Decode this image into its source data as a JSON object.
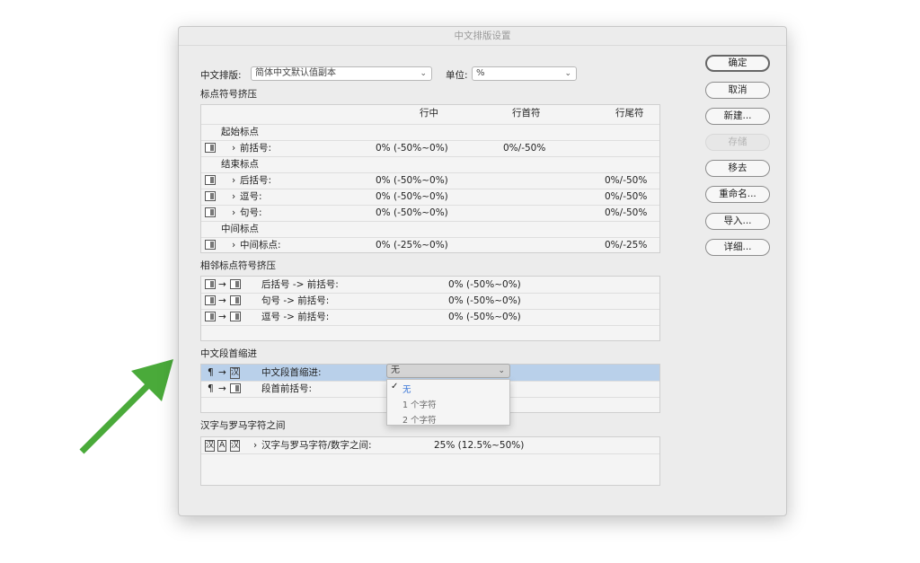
{
  "dialog": {
    "title": "中文排版设置"
  },
  "top": {
    "set_label": "中文排版:",
    "set_value": "简体中文默认值副本",
    "unit_label": "单位:",
    "unit_value": "%"
  },
  "punct": {
    "section": "标点符号挤压",
    "headers": [
      "行中",
      "行首符",
      "行尾符"
    ],
    "rows": [
      {
        "group": "起始标点"
      },
      {
        "label": "前括号:",
        "mid": "0% (-50%~0%)",
        "start": "0%/-50%",
        "end": ""
      },
      {
        "group": "结束标点"
      },
      {
        "label": "后括号:",
        "mid": "0% (-50%~0%)",
        "start": "",
        "end": "0%/-50%"
      },
      {
        "label": "逗号:",
        "mid": "0% (-50%~0%)",
        "start": "",
        "end": "0%/-50%"
      },
      {
        "label": "句号:",
        "mid": "0% (-50%~0%)",
        "start": "",
        "end": "0%/-50%"
      },
      {
        "group": "中间标点"
      },
      {
        "label": "中间标点:",
        "mid": "0% (-25%~0%)",
        "start": "",
        "end": "0%/-25%"
      }
    ]
  },
  "adjacent": {
    "section": "相邻标点符号挤压",
    "arrow": "→",
    "rows": [
      {
        "label": "后括号 -> 前括号:",
        "value": "0% (-50%~0%)"
      },
      {
        "label": "句号 -> 前括号:",
        "value": "0% (-50%~0%)"
      },
      {
        "label": "逗号 -> 前括号:",
        "value": "0% (-50%~0%)"
      }
    ]
  },
  "indent": {
    "section": "中文段首缩进",
    "pilcrow": "¶",
    "arrow": "→",
    "han": "汉",
    "rows": [
      {
        "label": "中文段首缩进:",
        "value": "无"
      },
      {
        "label": "段首前括号:",
        "value": ""
      }
    ],
    "menu": {
      "check": "✓",
      "options": [
        "无",
        "1 个字符",
        "2 个字符"
      ],
      "selected": 0
    }
  },
  "hanroman": {
    "section": "汉字与罗马字符之间",
    "icons": [
      "汉",
      "A",
      "汉"
    ],
    "chev": "›",
    "row_label": "汉字与罗马字符/数字之间:",
    "row_value": "25% (12.5%~50%)"
  },
  "buttons": [
    "确定",
    "取消",
    "新建...",
    "存储",
    "移去",
    "重命名...",
    "导入...",
    "详细..."
  ],
  "chev": "›",
  "dropdown_chevron": "⌄",
  "colors": {
    "highlight": "#b9d0ea",
    "arrow": "#4aaa3a",
    "checked": "#2f6fd6"
  }
}
